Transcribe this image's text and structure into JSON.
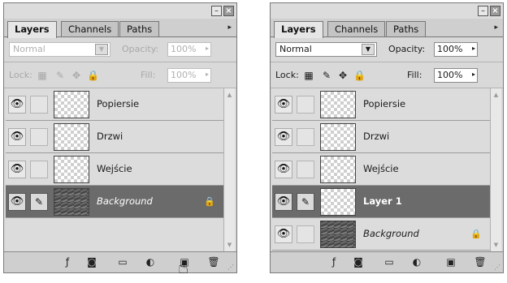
{
  "panels": {
    "left": {
      "tabs": [
        "Layers",
        "Channels",
        "Paths"
      ],
      "blend_mode": "Normal",
      "opacity_label": "Opacity:",
      "opacity_value": "100%",
      "lock_label": "Lock:",
      "fill_label": "Fill:",
      "fill_value": "100%",
      "layers": [
        {
          "name": "Popiersie"
        },
        {
          "name": "Drzwi"
        },
        {
          "name": "Wejście"
        },
        {
          "name": "Background"
        }
      ]
    },
    "right": {
      "tabs": [
        "Layers",
        "Channels",
        "Paths"
      ],
      "blend_mode": "Normal",
      "opacity_label": "Opacity:",
      "opacity_value": "100%",
      "lock_label": "Lock:",
      "fill_label": "Fill:",
      "fill_value": "100%",
      "layers": [
        {
          "name": "Popiersie"
        },
        {
          "name": "Drzwi"
        },
        {
          "name": "Wejście"
        },
        {
          "name": "Layer 1"
        },
        {
          "name": "Background"
        }
      ]
    }
  },
  "glyphs": {
    "eye": "👁",
    "brush": "✎",
    "lock": "🔒",
    "move": "✥",
    "checker": "▦",
    "link_style": "ƒ",
    "mask": "◙",
    "folder": "▭",
    "adjust": "◐",
    "new_layer": "▣",
    "trash": "🗑",
    "menu": "▸",
    "scroll_up": "▲",
    "scroll_down": "▼",
    "dropdown": "▼",
    "stepper": "▸",
    "hand_cursor": "☝",
    "close": "×",
    "minimize": "–",
    "grip": "⋰"
  },
  "colors": {
    "selected_row": "#6b6b6b",
    "panel_bg": "#d9d9d9"
  },
  "state": {
    "left_selected_layer": "Background",
    "right_selected_layer": "Layer 1",
    "left_options_disabled": true
  }
}
